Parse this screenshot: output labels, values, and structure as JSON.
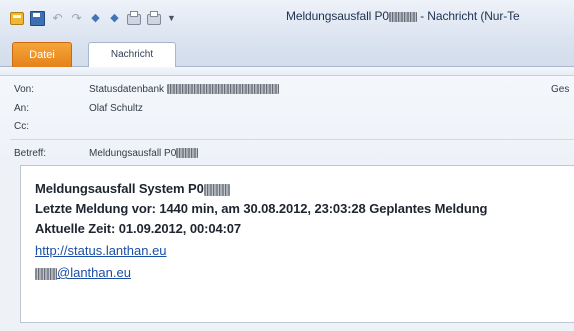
{
  "window": {
    "title_prefix": "Meldungsausfall P0",
    "title_suffix": " - Nachricht (Nur-Te"
  },
  "quick_access": {
    "icons": [
      "outlook-app-icon",
      "save-icon",
      "undo-icon",
      "redo-icon",
      "up-arrow-icon",
      "down-arrow-icon",
      "print-icon",
      "print-preview-icon",
      "customize-dropdown-icon"
    ]
  },
  "ribbon": {
    "tabs": [
      {
        "label": "Datei"
      },
      {
        "label": "Nachricht"
      }
    ]
  },
  "header": {
    "from_label": "Von:",
    "from_value": "Statusdatenbank ",
    "to_label": "An:",
    "to_value": "Olaf Schultz",
    "cc_label": "Cc:",
    "cc_value": "",
    "subject_label": "Betreff:",
    "subject_value": "Meldungsausfall P0",
    "sent_label": "Ges"
  },
  "message": {
    "line1": "Meldungsausfall System P0",
    "line2": "Letzte Meldung vor: 1440 min, am  30.08.2012, 23:03:28 Geplantes Meldung",
    "line3": "Aktuelle Zeit: 01.09.2012, 00:04:07",
    "link1": "http://status.lanthan.eu",
    "link2": "@lanthan.eu"
  }
}
